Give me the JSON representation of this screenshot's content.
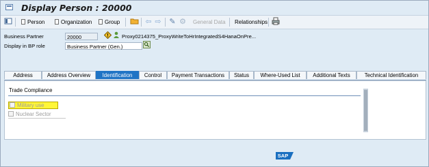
{
  "window": {
    "title": "Display Person : 20000"
  },
  "toolbar": {
    "person": "Person",
    "organization": "Organization",
    "group": "Group",
    "general_data": "General Data",
    "relationships": "Relationships"
  },
  "header": {
    "bp_label": "Business Partner",
    "bp_value": "20000",
    "bp_desc": "Proxy0214375_ProxyWriteToHrIntegratedS4HanaOnPre...",
    "role_label": "Display in BP role",
    "role_value": "Business Partner (Gen.)"
  },
  "tabs": [
    "Address",
    "Address Overview",
    "Identification",
    "Control",
    "Payment Transactions",
    "Status",
    "Where-Used List",
    "Additional Texts",
    "Technical Identification"
  ],
  "active_tab": "Identification",
  "trade": {
    "title": "Trade Compliance",
    "military": "Military use",
    "military_checked": false,
    "nuclear": "Nuclear Sector",
    "nuclear_checked": false
  },
  "footer": {
    "logo": "SAP"
  },
  "colors": {
    "active_tab": "#1f74c5",
    "highlight": "#fff637",
    "background": "#dfebf5"
  }
}
